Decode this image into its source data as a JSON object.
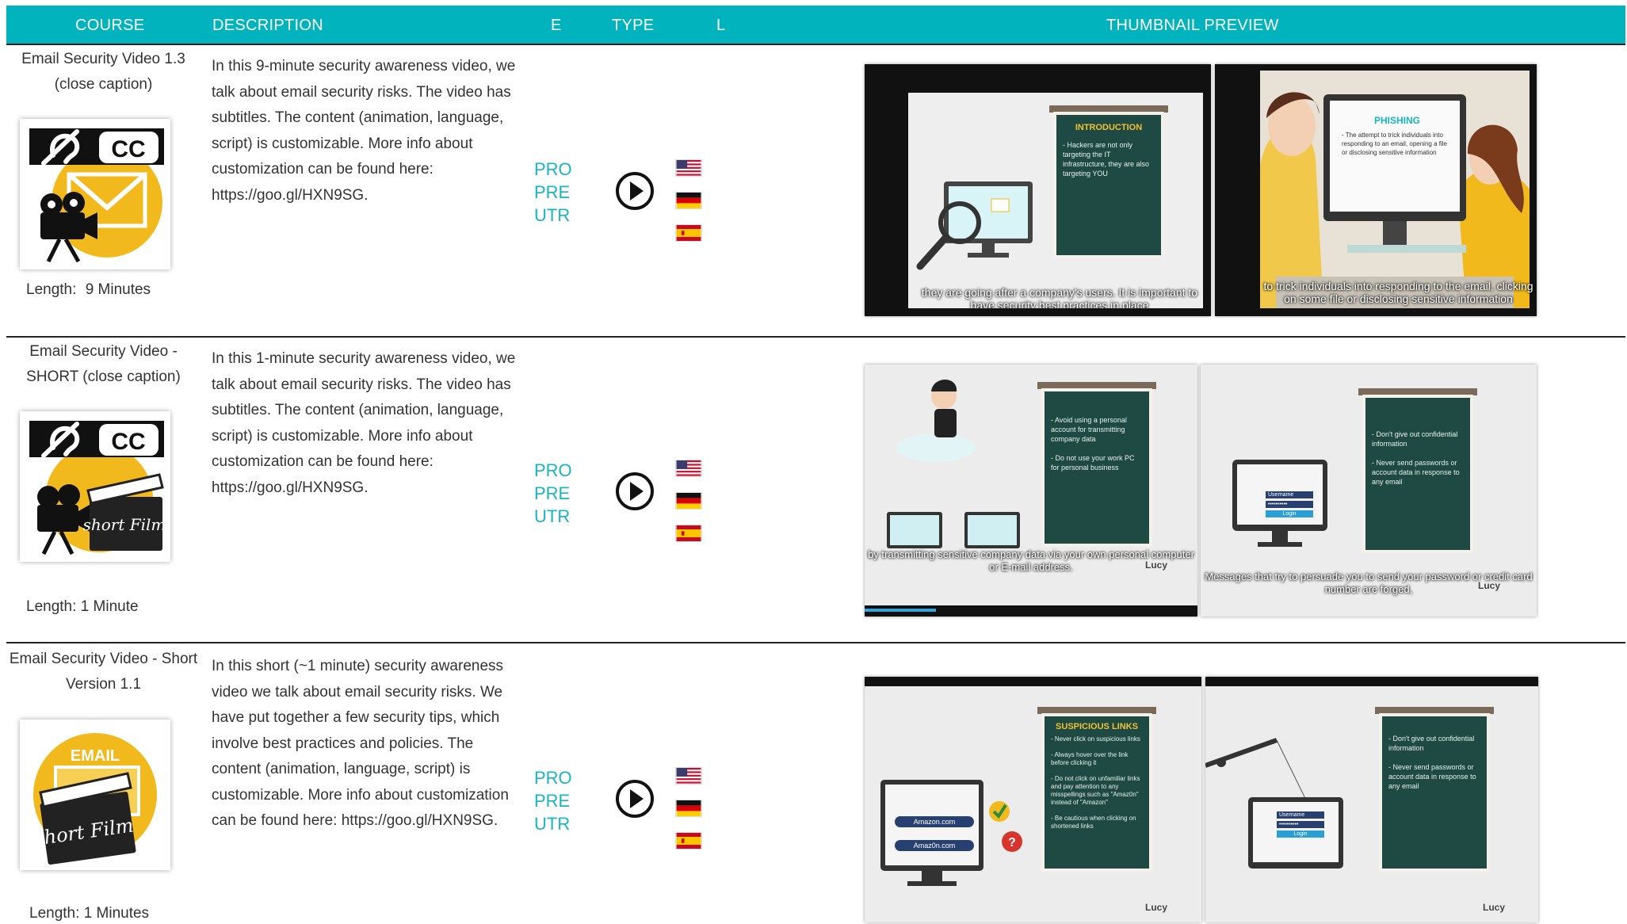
{
  "header": {
    "course": "COURSE",
    "description": "DESCRIPTION",
    "e": "E",
    "type": "TYPE",
    "l": "L",
    "thumbnail_preview": "THUMBNAIL PREVIEW"
  },
  "courses": [
    {
      "title": "Email Security Video 1.3 (close caption)",
      "length_label": "Length:",
      "length_value": "9 Minutes",
      "description": "In this 9-minute security awareness video, we talk about email security risks. The video has subtitles. The content (animation, language, script) is customizable. More info about customization can be found here: https://goo.gl/HXN9SG.",
      "types": [
        "PRO",
        "PRE",
        "UTR"
      ],
      "thumb1": {
        "board_title": "INTRODUCTION",
        "board_text": "- Hackers are not only targeting the IT infrastructure, they are also targeting YOU",
        "caption": "they are going after a company's users. It is important to have security best practices in place"
      },
      "thumb2": {
        "board_title": "PHISHING",
        "board_text": "- The attempt to trick individuals into responding to an email, opening a file or disclosing sensitive information",
        "caption": "to trick individuals into responding to the email, clicking on some file or disclosing sensitive information"
      }
    },
    {
      "title": "Email Security Video - SHORT (close caption)",
      "length_label": "Length:",
      "length_value": "1 Minute",
      "description": "In this 1-minute security awareness video, we talk about email security risks. The video has subtitles. The content (animation, language, script) is customizable. More info about customization can be found here: https://goo.gl/HXN9SG.",
      "types": [
        "PRO",
        "PRE",
        "UTR"
      ],
      "thumb1": {
        "board_text": "- Avoid using a personal account for transmitting company data\n\n- Do not use your work PC for personal business",
        "caption": "by transmitting sensitive company data via your own personal computer or E-mail address.",
        "logo": "Lucy"
      },
      "thumb2": {
        "board_text": "- Don't give out confidential information\n\n- Never send passwords or account data in response to any email",
        "caption": "Messages that try to persuade you to send your password or credit card number are forged,",
        "login_username": "Username",
        "login_password": "••••••••••",
        "login_button": "Login",
        "logo": "Lucy"
      }
    },
    {
      "title": "Email Security Video - Short Version 1.1",
      "length_label": "Length:",
      "length_value": "1 Minutes",
      "description": "In this short (~1 minute) security awareness video we talk about email security risks. We have put together a few security tips, which involve best practices and policies. The content (animation, language, script) is customizable. More info about customization can be found here: https://goo.gl/HXN9SG.",
      "types": [
        "PRO",
        "PRE",
        "UTR"
      ],
      "thumb1": {
        "board_title": "SUSPICIOUS LINKS",
        "board_text": "- Never click on suspicious links\n\n- Always hover over the link before clicking it\n\n- Do not click on unfamiliar links and pay attention to any misspellings such as \"Amaz0n\" instead of \"Amazon\"\n\n- Be cautious when clicking on shortened links",
        "link1": "Amazon.com",
        "link2": "Amaz0n.com",
        "logo": "Lucy"
      },
      "thumb2": {
        "board_text": "- Don't give out confidential information\n\n- Never send passwords or account data in response to any email",
        "login_username": "Username",
        "login_password": "••••••••••",
        "login_button": "Login",
        "logo": "Lucy"
      }
    }
  ],
  "icons": {
    "course1": [
      "hearing-icon",
      "cc-icon",
      "envelope-icon",
      "film-camera-icon"
    ],
    "course2": [
      "hearing-icon",
      "cc-icon",
      "film-camera-icon",
      "clapperboard-icon"
    ],
    "course3": [
      "envelope-icon",
      "clapperboard-icon"
    ],
    "play": "play-icon",
    "flags": [
      "flag-us-icon",
      "flag-de-icon",
      "flag-es-icon"
    ]
  },
  "colors": {
    "header_bg": "#00b3bd",
    "type_text": "#17b4c1",
    "envelope_yellow": "#f2b91d",
    "board": "#1f4a44"
  }
}
